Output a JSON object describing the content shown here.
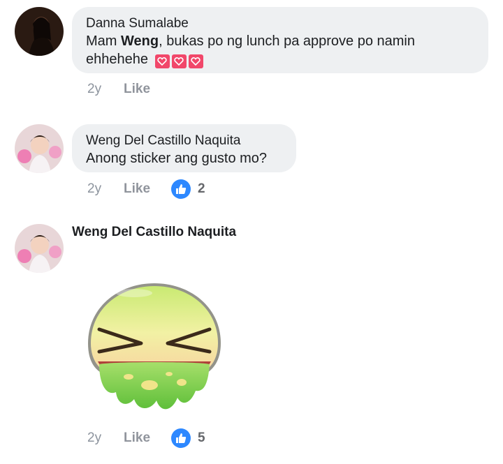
{
  "comments": [
    {
      "author": "Danna Sumalabe",
      "text_parts": [
        "Mam ",
        "Weng",
        ", bukas po ng lunch pa approve po namin",
        "ehhehehe"
      ],
      "emoji": "heart-emoji",
      "time": "2y",
      "like_label": "Like"
    },
    {
      "author": "Weng Del Castillo Naquita",
      "text": "Anong sticker ang gusto mo?",
      "time": "2y",
      "like_label": "Like",
      "reaction_count": "2"
    },
    {
      "author": "Weng Del Castillo Naquita",
      "sticker": "vomiting-face-sticker",
      "time": "2y",
      "like_label": "Like",
      "reaction_count": "5"
    }
  ],
  "colors": {
    "bubble": "#eef0f2",
    "like_badge": "#2d88ff",
    "heart": "#f1476a",
    "meta_text": "#8d949e"
  }
}
